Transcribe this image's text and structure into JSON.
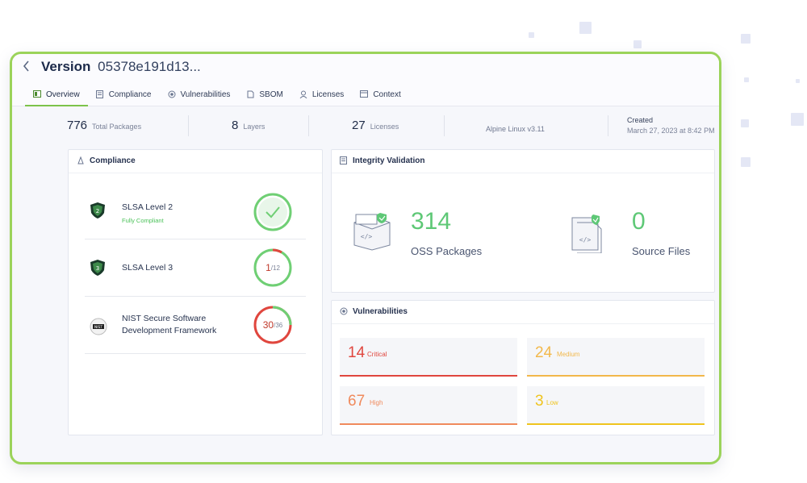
{
  "header": {
    "back_icon": "chevron-left-icon",
    "title_label": "Version",
    "title_hash": "05378e191d13..."
  },
  "tabs": [
    {
      "label": "Overview",
      "icon": "overview-icon",
      "active": true
    },
    {
      "label": "Compliance",
      "icon": "compliance-icon",
      "active": false
    },
    {
      "label": "Vulnerabilities",
      "icon": "vulnerabilities-icon",
      "active": false
    },
    {
      "label": "SBOM",
      "icon": "sbom-icon",
      "active": false
    },
    {
      "label": "Licenses",
      "icon": "licenses-icon",
      "active": false
    },
    {
      "label": "Context",
      "icon": "context-icon",
      "active": false
    }
  ],
  "stats": {
    "packages": {
      "value": "776",
      "label": "Total Packages"
    },
    "layers": {
      "value": "8",
      "label": "Layers"
    },
    "licenses": {
      "value": "27",
      "label": "Licenses"
    },
    "os": "Alpine Linux v3.11",
    "created_label": "Created",
    "created_value": "March 27, 2023 at 8:42 PM"
  },
  "compliance": {
    "title": "Compliance",
    "items": [
      {
        "name": "SLSA Level 2",
        "badge": "2",
        "status": "Fully Compliant",
        "passed": 1,
        "total": 1
      },
      {
        "name": "SLSA Level 3",
        "badge": "3",
        "status": "",
        "score": "1",
        "score_total": "/12",
        "passed": 1,
        "total": 12
      },
      {
        "name": "NIST Secure Software Development Framework",
        "badge": "NIST",
        "status": "",
        "score": "30",
        "score_total": "/36",
        "passed": 30,
        "total": 36
      }
    ]
  },
  "integrity": {
    "title": "Integrity Validation",
    "oss_value": "314",
    "oss_label": "OSS Packages",
    "src_value": "0",
    "src_label": "Source Files"
  },
  "vulnerabilities": {
    "title": "Vulnerabilities",
    "critical": {
      "value": "14",
      "label": "Critical",
      "color": "#e0463e"
    },
    "medium": {
      "value": "24",
      "label": "Medium",
      "color": "#f2b84b"
    },
    "high": {
      "value": "67",
      "label": "High",
      "color": "#f08a5c"
    },
    "low": {
      "value": "3",
      "label": "Low",
      "color": "#efc41e"
    }
  },
  "colors": {
    "accent_green": "#7cc34a",
    "success": "#5ec876",
    "danger": "#e0463e"
  }
}
